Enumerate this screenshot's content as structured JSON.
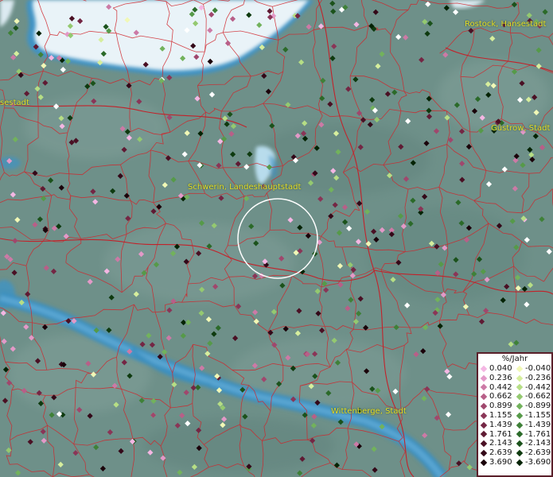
{
  "map": {
    "cities": [
      {
        "name": "Rostock, Hansestadt"
      },
      {
        "name": "sestadt"
      },
      {
        "name": "Güstrow, Stadt"
      },
      {
        "name": "Schwerin, Landeshauptstadt"
      },
      {
        "name": "Wittenberge, Stadt"
      }
    ],
    "colors": {
      "land": "#6e9089",
      "water": "#e9f3f8",
      "river": "#3a8fc0",
      "boundaries": "#d0262c",
      "label": "#e6df2a",
      "selection_circle": "#ffffff"
    }
  },
  "legend": {
    "title": "%/Jahr",
    "positive": [
      {
        "value": "0.040",
        "color": "#f4b6e3"
      },
      {
        "value": "0.236",
        "color": "#e399c8"
      },
      {
        "value": "0.442",
        "color": "#cc7aa6"
      },
      {
        "value": "0.662",
        "color": "#b85f88"
      },
      {
        "value": "0.899",
        "color": "#a0476d"
      },
      {
        "value": "1.155",
        "color": "#8a3557"
      },
      {
        "value": "1.439",
        "color": "#742644"
      },
      {
        "value": "1.761",
        "color": "#5f1a33"
      },
      {
        "value": "2.143",
        "color": "#4a1024"
      },
      {
        "value": "2.639",
        "color": "#330818"
      },
      {
        "value": "3.690",
        "color": "#1a020a"
      }
    ],
    "negative": [
      {
        "value": "-0.040",
        "color": "#f1f8b6"
      },
      {
        "value": "-0.236",
        "color": "#d6ee9d"
      },
      {
        "value": "-0.442",
        "color": "#b6de85"
      },
      {
        "value": "-0.662",
        "color": "#94c970"
      },
      {
        "value": "-0.899",
        "color": "#72b25c"
      },
      {
        "value": "-1.155",
        "color": "#569a49"
      },
      {
        "value": "-1.439",
        "color": "#3f8138"
      },
      {
        "value": "-1.761",
        "color": "#2b6a29"
      },
      {
        "value": "-2.143",
        "color": "#1b521b"
      },
      {
        "value": "-2.639",
        "color": "#0e3a0f"
      },
      {
        "value": "-3.690",
        "color": "#042304"
      }
    ],
    "white_marker_color": "#ffffff"
  }
}
